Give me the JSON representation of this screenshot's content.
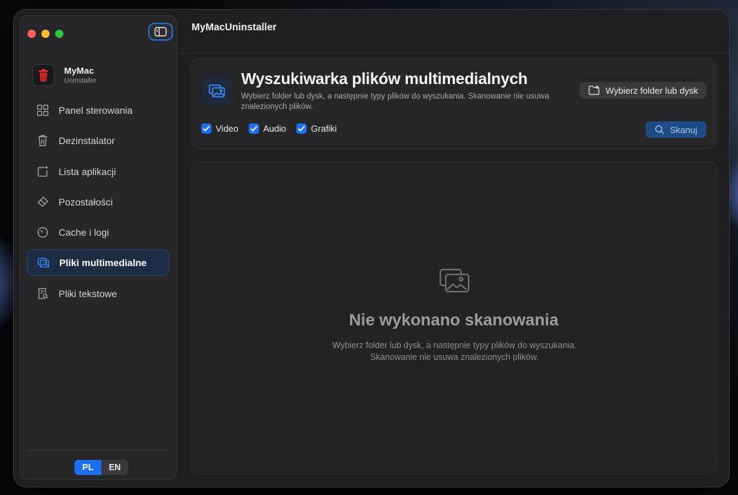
{
  "app": {
    "title": "MyMacUninstaller"
  },
  "brand": {
    "name": "MyMac",
    "subtitle": "Uninstaller",
    "logo_icon": "trash-logo-icon"
  },
  "sidebar": {
    "items": [
      {
        "label": "Panel sterowania",
        "icon": "grid-icon",
        "active": false
      },
      {
        "label": "Dezinstalator",
        "icon": "trash-icon",
        "active": false
      },
      {
        "label": "Lista aplikacji",
        "icon": "app-list-icon",
        "active": false
      },
      {
        "label": "Pozostałości",
        "icon": "eraser-icon",
        "active": false
      },
      {
        "label": "Cache i logi",
        "icon": "gauge-icon",
        "active": false
      },
      {
        "label": "Pliki multimedialne",
        "icon": "photos-icon",
        "active": true
      },
      {
        "label": "Pliki tekstowe",
        "icon": "document-search-icon",
        "active": false
      }
    ],
    "languages": [
      {
        "code": "PL",
        "selected": true
      },
      {
        "code": "EN",
        "selected": false
      }
    ]
  },
  "header": {
    "title": "Wyszukiwarka plików multimedialnych",
    "description": "Wybierz folder lub dysk, a następnie typy plików do wyszukania. Skanowanie nie usuwa znalezionych plików.",
    "choose_button": "Wybierz folder lub dysk",
    "scan_button": "Skanuj",
    "filters": [
      {
        "label": "Video",
        "checked": true
      },
      {
        "label": "Audio",
        "checked": true
      },
      {
        "label": "Grafiki",
        "checked": true
      }
    ]
  },
  "empty_state": {
    "title": "Nie wykonano skanowania",
    "description": "Wybierz folder lub dysk, a następnie typy plików do wyszukania. Skanowanie nie usuwa znalezionych plików."
  },
  "colors": {
    "accent": "#1d6ff2",
    "scan_button": "#1e4a86",
    "window_bg": "#1f1f21"
  }
}
